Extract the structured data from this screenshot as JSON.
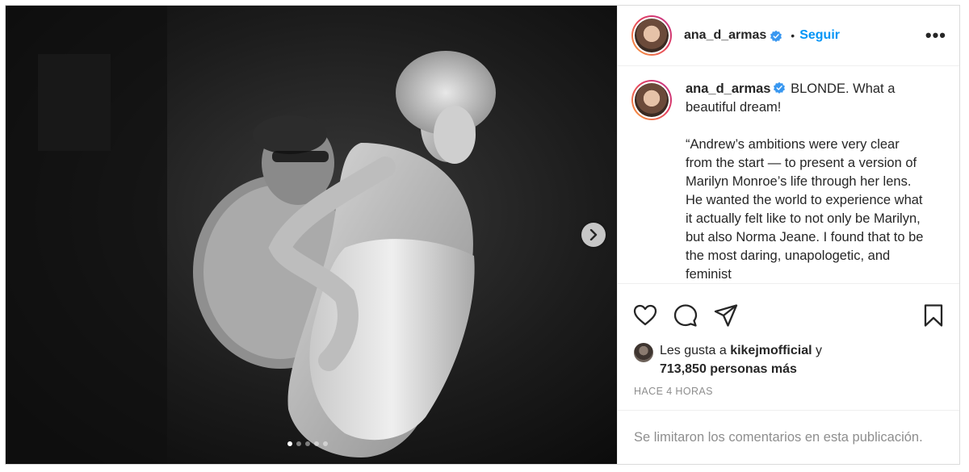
{
  "post": {
    "username": "ana_d_armas",
    "follow_label": "Seguir",
    "separator": "•",
    "more_label": "•••"
  },
  "caption": {
    "username": "ana_d_armas",
    "line1": "BLONDE. What a beautiful dream!",
    "paragraph": "“Andrew’s ambitions were very clear from the start — to present a version of Marilyn Monroe’s life through her lens. He wanted the world to experience what it actually felt like to not only be Marilyn, but also Norma Jeane. I found that to be the most daring, unapologetic, and feminist"
  },
  "likes": {
    "prefix": "Les gusta a",
    "user": "kikejmofficial",
    "connector": "y",
    "count_text": "713,850 personas más"
  },
  "timestamp": "HACE 4 HORAS",
  "comments_note": "Se limitaron los comentarios en esta publicación.",
  "carousel": {
    "total": 5,
    "current": 1
  },
  "icons": {
    "verified": "verified-badge-icon",
    "like": "heart-icon",
    "comment": "comment-bubble-icon",
    "share": "paper-plane-icon",
    "save": "bookmark-icon",
    "next": "chevron-right-icon"
  },
  "colors": {
    "link": "#0095f6",
    "verified": "#3897f0",
    "muted": "#8e8e8e",
    "text": "#262626"
  }
}
